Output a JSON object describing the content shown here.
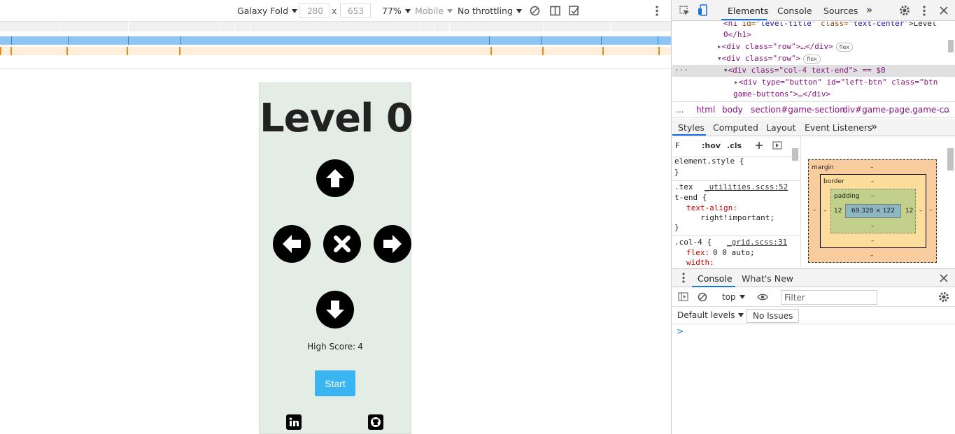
{
  "device_toolbar": {
    "device": "Galaxy Fold",
    "width": "280",
    "times": "x",
    "height": "653",
    "zoom": "77%",
    "mode": "Mobile",
    "throttling": "No throttling"
  },
  "game": {
    "title": "Level 0",
    "high_score_label": "High Score:",
    "high_score_value": "4",
    "start_label": "Start",
    "colors": {
      "background": "#e3ede6",
      "start": "#3bb4f2"
    }
  },
  "devtools": {
    "tabs": [
      "Elements",
      "Console",
      "Sources"
    ],
    "more": "»",
    "dom": {
      "line1_tag": "<h1",
      "line1_attr1": "id=",
      "line1_val1": "\"level-title\"",
      "line1_attr2": "class=",
      "line1_val2": "\"text-center\"",
      "line1_text": ">Level",
      "line2": "0</h1>",
      "line3": "<div class=\"row\">…</div>",
      "line4": "<div class=\"row\">",
      "flex_badge": "flex",
      "line5": "<div class=\"col-4 text-end\"> == $0",
      "line6": "<div type=\"button\" id=\"left-btn\" class=\"btn",
      "line7": "game-buttons\">…</div>"
    },
    "breadcrumb": [
      "...",
      "html",
      "body",
      "section#game-section",
      "div#game-page.game-co",
      "..."
    ],
    "style_tabs": [
      "Styles",
      "Computed",
      "Layout",
      "Event Listeners",
      "»"
    ],
    "styles_filter": "F",
    "hov": ":hov",
    "cls": ".cls",
    "styles_rules": {
      "r1": "element.style {",
      "r2": "}",
      "r3_sel": ".tex",
      "r3_src": "_utilities.scss:52",
      "r4": "t-end {",
      "r5_prop": "text-align:",
      "r6_val": "right!important;",
      "r7": "}",
      "r8_sel": ".col-4 {",
      "r8_src": "_grid.scss:31",
      "r9_prop": "flex:",
      "r9_val": "0 0 auto;",
      "r10_prop": "width:"
    },
    "box_model": {
      "margin_label": "margin",
      "border_label": "border",
      "padding_label": "padding",
      "dash": "–",
      "padding_left": "12",
      "padding_right": "12",
      "content": "69.328 × 122"
    },
    "console": {
      "tabs": [
        "Console",
        "What's New"
      ],
      "context": "top",
      "filter_placeholder": "Filter",
      "levels": "Default levels",
      "issues": "No Issues",
      "prompt": ">"
    }
  }
}
